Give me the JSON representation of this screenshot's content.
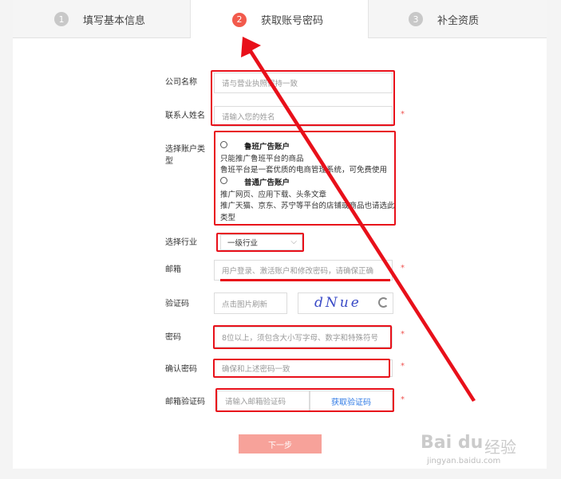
{
  "steps": [
    {
      "num": "1",
      "label": "填写基本信息"
    },
    {
      "num": "2",
      "label": "获取账号密码"
    },
    {
      "num": "3",
      "label": "补全资质"
    }
  ],
  "form": {
    "company_label": "公司名称",
    "company_placeholder": "请与营业执照保持一致",
    "contact_label": "联系人姓名",
    "contact_placeholder": "请输入您的姓名",
    "account_type_label": "选择账户类型",
    "option1_title": "鲁班广告账户",
    "option1_desc1": "只能推广鲁班平台的商品",
    "option1_desc2": "鲁班平台是一套优质的电商管理系统，可免费使用",
    "option2_title": "普通广告账户",
    "option2_desc1": "推广网页、应用下载、头条文章",
    "option2_desc2": "推广天猫、京东、苏宁等平台的店铺或商品也请选此类型",
    "industry_label": "选择行业",
    "industry_value": "一级行业",
    "email_label": "邮箱",
    "email_placeholder": "用户登录、激活账户和修改密码，请确保正确",
    "captcha_label": "验证码",
    "captcha_placeholder": "点击图片刷新",
    "captcha_text": "dNue",
    "password_label": "密码",
    "password_placeholder": "8位以上，须包含大小写字母、数字和特殊符号",
    "confirm_label": "确认密码",
    "confirm_placeholder": "确保和上述密码一致",
    "emailcode_label": "邮箱验证码",
    "emailcode_placeholder": "请输入邮箱验证码",
    "get_code_label": "获取验证码",
    "star": "*",
    "next_label": "下一步"
  },
  "watermark": {
    "logo": "Bai du",
    "cn": "经验",
    "url": "jingyan.baidu.com"
  },
  "colors": {
    "accent": "#f25a4c",
    "annotation": "#e8101a",
    "link": "#2f7ae5"
  }
}
